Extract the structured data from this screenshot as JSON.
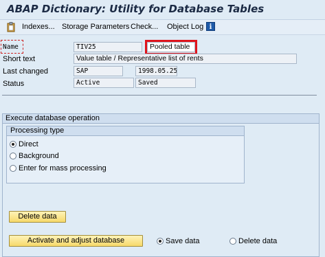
{
  "title": "ABAP Dictionary: Utility for Database Tables",
  "toolbar": {
    "items": [
      "Indexes...",
      "Storage Parameters",
      "Check...",
      "Object Log"
    ],
    "info_icon_glyph": "i"
  },
  "header": {
    "name_label": "Name",
    "name_value": "TIV25",
    "table_type": "Pooled table",
    "short_text_label": "Short text",
    "short_text_value": "Value table / Representative list of rents",
    "last_changed_label": "Last changed",
    "last_changed_user": "SAP",
    "last_changed_date": "1998.05.25",
    "status_label": "Status",
    "status_value": "Active",
    "status_saved": "Saved"
  },
  "operation": {
    "title": "Execute database operation",
    "processing_type_title": "Processing type",
    "processing_options": [
      {
        "label": "Direct",
        "selected": true
      },
      {
        "label": "Background",
        "selected": false
      },
      {
        "label": "Enter for mass processing",
        "selected": false
      }
    ],
    "delete_button": "Delete data",
    "activate_button": "Activate and adjust database",
    "data_options": [
      {
        "label": "Save data",
        "selected": true
      },
      {
        "label": "Delete data",
        "selected": false
      }
    ]
  },
  "colors": {
    "highlight": "#e0141c",
    "button_fill": "#f6d96a",
    "background": "#dfebf5"
  }
}
